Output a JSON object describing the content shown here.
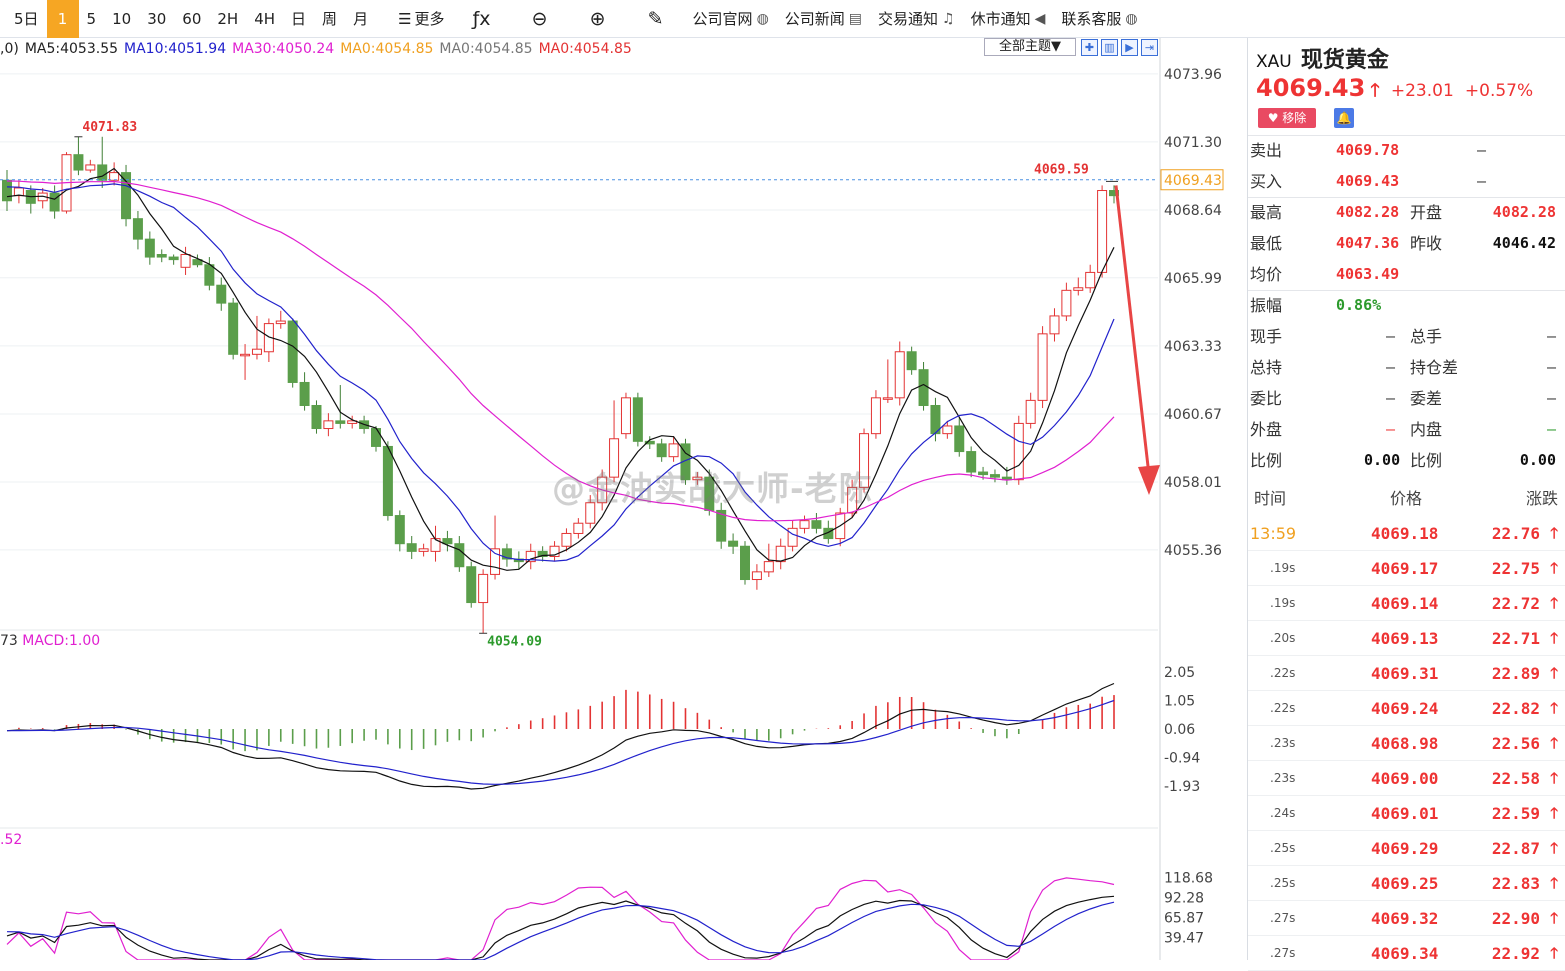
{
  "toolbar": {
    "periods": [
      "5日",
      "1",
      "5",
      "10",
      "30",
      "60",
      "2H",
      "4H",
      "日",
      "周",
      "月"
    ],
    "active_period": "1",
    "more_label": "更多",
    "links": [
      {
        "label": "公司官网",
        "icon": "globe-icon",
        "glyph": "◍"
      },
      {
        "label": "公司新闻",
        "icon": "news-icon",
        "glyph": "▤"
      },
      {
        "label": "交易通知",
        "icon": "bell-icon",
        "glyph": "♫"
      },
      {
        "label": "休市通知",
        "icon": "speaker-icon",
        "glyph": "◀"
      },
      {
        "label": "联系客服",
        "icon": "support-icon",
        "glyph": "◍"
      }
    ]
  },
  "ma_legend": [
    {
      "text": ",0)",
      "color": "#222222"
    },
    {
      "text": "MA5:4053.55",
      "color": "#222222"
    },
    {
      "text": "MA10:4051.94",
      "color": "#2222cc"
    },
    {
      "text": "MA30:4050.24",
      "color": "#e020d0"
    },
    {
      "text": "MA0:4054.85",
      "color": "#f0a020"
    },
    {
      "text": "MA0:4054.85",
      "color": "#777777"
    },
    {
      "text": "MA0:4054.85",
      "color": "#e33333"
    }
  ],
  "theme_selector": "全部主题▼",
  "macd_legend": {
    "prefix": "73",
    "text": "MACD:1.00"
  },
  "kdj_legend": ".52",
  "watermark": "@金油实战大师-老陈",
  "colors": {
    "up": "#e33333",
    "down": "#5b9e4b",
    "ma5": "#111111",
    "ma10": "#2222cc",
    "ma30": "#e020d0",
    "arrow": "#e84545"
  },
  "chart_data": {
    "type": "candlestick",
    "main": {
      "y_ticks": [
        "4073.96",
        "4071.30",
        "4068.64",
        "4065.99",
        "4063.33",
        "4060.67",
        "4058.01",
        "4055.36"
      ],
      "ylim": [
        4053.4,
        4074.5
      ],
      "last_price_tag": "4069.43",
      "last_price": 4069.43,
      "high_label": "4071.83",
      "low_label": "4054.09",
      "recent_high_label": "4069.59",
      "candles": [
        [
          4069.8,
          4069.0,
          4070.2,
          4068.6
        ],
        [
          4069.2,
          4069.5,
          4069.8,
          4068.9
        ],
        [
          4069.4,
          4068.9,
          4069.6,
          4068.5
        ],
        [
          4069.0,
          4069.3,
          4069.5,
          4068.7
        ],
        [
          4069.3,
          4068.6,
          4069.6,
          4068.3
        ],
        [
          4068.6,
          4070.8,
          4070.9,
          4068.5
        ],
        [
          4070.8,
          4070.2,
          4071.5,
          4070.0
        ],
        [
          4070.2,
          4070.4,
          4070.6,
          4070.1
        ],
        [
          4070.4,
          4069.8,
          4071.5,
          4069.5
        ],
        [
          4069.8,
          4070.1,
          4070.5,
          4069.6
        ],
        [
          4070.1,
          4068.3,
          4070.4,
          4068.0
        ],
        [
          4068.3,
          4067.5,
          4068.6,
          4067.1
        ],
        [
          4067.5,
          4066.8,
          4067.8,
          4066.5
        ],
        [
          4066.9,
          4066.8,
          4067.1,
          4066.6
        ],
        [
          4066.8,
          4066.7,
          4066.9,
          4066.5
        ],
        [
          4066.4,
          4066.9,
          4067.2,
          4066.1
        ],
        [
          4066.7,
          4066.5,
          4066.9,
          4066.4
        ],
        [
          4066.5,
          4065.7,
          4066.8,
          4065.5
        ],
        [
          4065.7,
          4065.0,
          4066.0,
          4064.7
        ],
        [
          4065.0,
          4063.0,
          4065.2,
          4062.8
        ],
        [
          4063.0,
          4063.0,
          4063.4,
          4062.0
        ],
        [
          4063.0,
          4063.2,
          4064.5,
          4062.8
        ],
        [
          4063.1,
          4064.2,
          4064.4,
          4062.7
        ],
        [
          4064.2,
          4064.3,
          4064.7,
          4064.0
        ],
        [
          4064.3,
          4061.9,
          4064.4,
          4061.7
        ],
        [
          4061.9,
          4061.0,
          4062.3,
          4060.8
        ],
        [
          4061.0,
          4060.1,
          4061.2,
          4059.9
        ],
        [
          4060.1,
          4060.4,
          4060.7,
          4059.8
        ],
        [
          4060.4,
          4060.3,
          4061.8,
          4060.1
        ],
        [
          4060.3,
          4060.4,
          4060.6,
          4060.1
        ],
        [
          4060.4,
          4060.1,
          4060.6,
          4059.9
        ],
        [
          4060.1,
          4059.4,
          4060.2,
          4059.2
        ],
        [
          4059.4,
          4056.7,
          4059.6,
          4056.5
        ],
        [
          4056.7,
          4055.6,
          4056.9,
          4055.3
        ],
        [
          4055.6,
          4055.3,
          4055.9,
          4055.0
        ],
        [
          4055.3,
          4055.4,
          4055.6,
          4055.1
        ],
        [
          4055.3,
          4055.8,
          4056.3,
          4054.9
        ],
        [
          4055.8,
          4055.6,
          4056.1,
          4055.3
        ],
        [
          4055.6,
          4054.7,
          4055.9,
          4054.5
        ],
        [
          4054.7,
          4053.3,
          4054.9,
          4053.1
        ],
        [
          4053.3,
          4054.4,
          4054.6,
          4052.1
        ],
        [
          4054.4,
          4055.4,
          4056.7,
          4054.2
        ],
        [
          4055.4,
          4055.0,
          4055.6,
          4054.7
        ],
        [
          4055.0,
          4054.9,
          4055.3,
          4054.6
        ],
        [
          4054.9,
          4055.3,
          4055.6,
          4054.6
        ],
        [
          4055.3,
          4055.1,
          4055.5,
          4054.9
        ],
        [
          4055.1,
          4055.5,
          4055.7,
          4054.9
        ],
        [
          4055.5,
          4056.0,
          4056.2,
          4055.3
        ],
        [
          4056.0,
          4056.4,
          4056.6,
          4055.8
        ],
        [
          4056.4,
          4057.2,
          4057.5,
          4056.2
        ],
        [
          4057.2,
          4058.2,
          4058.5,
          4056.9
        ],
        [
          4058.2,
          4059.7,
          4061.2,
          4058.0
        ],
        [
          4059.9,
          4061.3,
          4061.5,
          4059.7
        ],
        [
          4061.3,
          4059.6,
          4061.5,
          4059.4
        ],
        [
          4059.6,
          4059.5,
          4059.8,
          4059.3
        ],
        [
          4059.5,
          4059.0,
          4059.7,
          4058.8
        ],
        [
          4059.0,
          4059.5,
          4059.8,
          4058.8
        ],
        [
          4059.5,
          4058.1,
          4059.7,
          4057.9
        ],
        [
          4058.1,
          4058.2,
          4058.4,
          4057.9
        ],
        [
          4058.2,
          4056.9,
          4058.5,
          4056.7
        ],
        [
          4056.9,
          4055.7,
          4057.2,
          4055.4
        ],
        [
          4055.7,
          4055.5,
          4056.0,
          4055.2
        ],
        [
          4055.5,
          4054.2,
          4055.7,
          4054.0
        ],
        [
          4054.2,
          4054.5,
          4054.8,
          4053.8
        ],
        [
          4054.5,
          4054.9,
          4055.6,
          4054.3
        ],
        [
          4054.9,
          4055.5,
          4055.8,
          4054.6
        ],
        [
          4055.5,
          4056.2,
          4056.5,
          4055.3
        ],
        [
          4056.2,
          4056.5,
          4056.7,
          4056.0
        ],
        [
          4056.5,
          4056.2,
          4056.8,
          4056.0
        ],
        [
          4056.2,
          4055.8,
          4056.5,
          4055.6
        ],
        [
          4055.8,
          4056.8,
          4057.0,
          4055.5
        ],
        [
          4056.8,
          4057.8,
          4058.1,
          4056.6
        ],
        [
          4057.8,
          4059.9,
          4060.1,
          4057.6
        ],
        [
          4059.9,
          4061.3,
          4061.6,
          4059.7
        ],
        [
          4061.3,
          4061.3,
          4062.8,
          4061.1
        ],
        [
          4061.3,
          4063.1,
          4063.5,
          4061.0
        ],
        [
          4063.1,
          4062.4,
          4063.3,
          4062.2
        ],
        [
          4062.4,
          4061.0,
          4062.7,
          4060.8
        ],
        [
          4061.0,
          4059.9,
          4061.3,
          4059.6
        ],
        [
          4059.9,
          4060.2,
          4060.4,
          4059.7
        ],
        [
          4060.2,
          4059.2,
          4060.5,
          4059.0
        ],
        [
          4059.2,
          4058.4,
          4059.4,
          4058.2
        ],
        [
          4058.4,
          4058.3,
          4058.6,
          4058.1
        ],
        [
          4058.3,
          4058.2,
          4058.5,
          4058.0
        ],
        [
          4058.2,
          4058.1,
          4058.6,
          4057.9
        ],
        [
          4058.1,
          4060.3,
          4060.6,
          4057.9
        ],
        [
          4060.3,
          4061.2,
          4061.5,
          4060.1
        ],
        [
          4061.2,
          4063.8,
          4064.1,
          4060.9
        ],
        [
          4063.8,
          4064.5,
          4064.8,
          4063.5
        ],
        [
          4064.5,
          4065.5,
          4065.8,
          4064.3
        ],
        [
          4065.5,
          4065.6,
          4066.0,
          4065.3
        ],
        [
          4065.6,
          4066.2,
          4066.5,
          4065.4
        ],
        [
          4066.2,
          4069.4,
          4069.6,
          4066.0
        ],
        [
          4069.4,
          4069.2,
          4069.6,
          4068.9
        ]
      ]
    },
    "macd": {
      "y_ticks": [
        "2.05",
        "1.05",
        "0.06",
        "-0.94",
        "-1.93"
      ],
      "ylim": [
        -2.6,
        2.3
      ]
    },
    "kdj": {
      "y_ticks": [
        "118.68",
        "92.28",
        "65.87",
        "39.47"
      ],
      "ylim": [
        10,
        135
      ]
    }
  },
  "side": {
    "symbol_code": "XAU",
    "symbol_name": "现货黄金",
    "last_price": "4069.43",
    "change": "+23.01",
    "change_pct": "+0.57%",
    "remove_label": "♥ 移除",
    "quote_rows": [
      {
        "l": "卖出",
        "v": "4069.78",
        "l2": "",
        "v2": "—",
        "type": "single"
      },
      {
        "l": "买入",
        "v": "4069.43",
        "l2": "",
        "v2": "—",
        "type": "single"
      },
      {
        "l": "最高",
        "v": "4082.28",
        "l2": "开盘",
        "v2": "4082.28",
        "type": "pair"
      },
      {
        "l": "最低",
        "v": "4047.36",
        "l2": "昨收",
        "v2": "4046.42",
        "type": "pair-black"
      },
      {
        "l": "均价",
        "v": "4063.49",
        "l2": "",
        "v2": "",
        "type": "single"
      },
      {
        "l": "振幅",
        "v": "0.86%",
        "l2": "",
        "v2": "",
        "type": "green"
      },
      {
        "l": "现手",
        "v": "—",
        "l2": "总手",
        "v2": "—",
        "type": "dash"
      },
      {
        "l": "总持",
        "v": "—",
        "l2": "持仓差",
        "v2": "—",
        "type": "dash"
      },
      {
        "l": "委比",
        "v": "—",
        "l2": "委差",
        "v2": "—",
        "type": "dash"
      },
      {
        "l": "外盘",
        "v": "—",
        "l2": "内盘",
        "v2": "—",
        "type": "dash-color"
      },
      {
        "l": "比例",
        "v": "0.00",
        "l2": "比例",
        "v2": "0.00",
        "type": "black"
      }
    ],
    "tick_header": {
      "time": "时间",
      "price": "价格",
      "change": "涨跌"
    },
    "ticks": [
      {
        "t": "13:59",
        "p": "4069.18",
        "c": "22.76"
      },
      {
        "t": ".19s",
        "p": "4069.17",
        "c": "22.75"
      },
      {
        "t": ".19s",
        "p": "4069.14",
        "c": "22.72"
      },
      {
        "t": ".20s",
        "p": "4069.13",
        "c": "22.71"
      },
      {
        "t": ".22s",
        "p": "4069.31",
        "c": "22.89"
      },
      {
        "t": ".22s",
        "p": "4069.24",
        "c": "22.82"
      },
      {
        "t": ".23s",
        "p": "4068.98",
        "c": "22.56"
      },
      {
        "t": ".23s",
        "p": "4069.00",
        "c": "22.58"
      },
      {
        "t": ".24s",
        "p": "4069.01",
        "c": "22.59"
      },
      {
        "t": ".25s",
        "p": "4069.29",
        "c": "22.87"
      },
      {
        "t": ".25s",
        "p": "4069.25",
        "c": "22.83"
      },
      {
        "t": ".27s",
        "p": "4069.32",
        "c": "22.90"
      },
      {
        "t": ".27s",
        "p": "4069.34",
        "c": "22.92"
      }
    ]
  }
}
